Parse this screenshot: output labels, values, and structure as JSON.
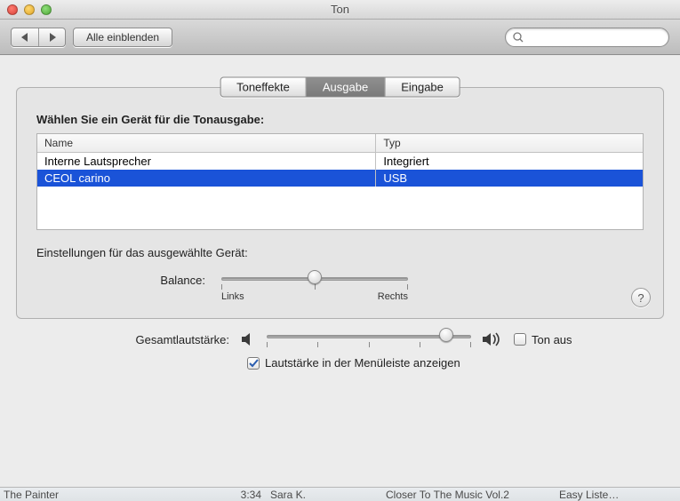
{
  "window": {
    "title": "Ton"
  },
  "toolbar": {
    "show_all": "Alle einblenden",
    "search_placeholder": ""
  },
  "tabs": {
    "effects": "Toneffekte",
    "output": "Ausgabe",
    "input": "Eingabe",
    "active": "output"
  },
  "output_pane": {
    "choose_lead": "Wählen Sie ein Gerät für die Tonausgabe:",
    "columns": {
      "name": "Name",
      "type": "Typ"
    },
    "devices": [
      {
        "name": "Interne Lautsprecher",
        "type": "Integriert",
        "selected": false
      },
      {
        "name": "CEOL carino",
        "type": "USB",
        "selected": true
      }
    ],
    "settings_lead": "Einstellungen für das ausgewählte Gerät:",
    "balance": {
      "label": "Balance:",
      "left": "Links",
      "right": "Rechts",
      "value_pct": 50
    }
  },
  "master": {
    "label": "Gesamtlautstärke:",
    "value_pct": 88,
    "mute_label": "Ton aus",
    "mute_checked": false,
    "menubar_label": "Lautstärke in der Menüleiste anzeigen",
    "menubar_checked": true
  },
  "background_row": {
    "c1": "The Painter",
    "c2": "3:34",
    "c3": "Sara K.",
    "c4": "Closer To The Music Vol.2",
    "c5": "Easy Liste…"
  }
}
